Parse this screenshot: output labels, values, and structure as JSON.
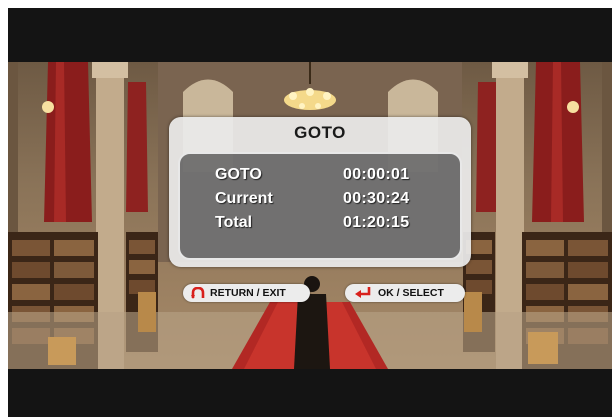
{
  "dialog": {
    "title": "GOTO",
    "rows": [
      {
        "label": "GOTO",
        "value": "00:00:01"
      },
      {
        "label": "Current",
        "value": "00:30:24"
      },
      {
        "label": "Total",
        "value": "01:20:15"
      }
    ]
  },
  "hints": {
    "return_label": "RETURN / EXIT",
    "return_icon": "return-arrow-icon",
    "ok_label": "OK / SELECT",
    "ok_icon": "enter-arrow-icon"
  },
  "colors": {
    "dialog_bg": "#ebebeb",
    "panel_border": "#e8e8e8",
    "icon_red": "#d8201c",
    "letterbox": "#141414"
  }
}
